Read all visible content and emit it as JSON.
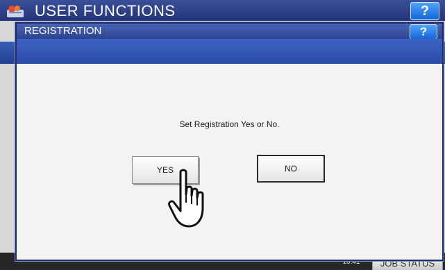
{
  "background": {
    "title": "USER FUNCTIONS",
    "help_label": "?",
    "time_text": "10:41",
    "job_status_label": "JOB STATUS"
  },
  "dialog": {
    "title": "REGISTRATION",
    "help_label": "?",
    "message": "Set Registration Yes or No.",
    "yes_label": "YES",
    "no_label": "NO"
  },
  "colors": {
    "accent_blue": "#2c4492",
    "help_blue": "#1466d6"
  },
  "icons": {
    "app_logo": "app-logo-icon",
    "pointer": "hand-pointer-icon"
  }
}
